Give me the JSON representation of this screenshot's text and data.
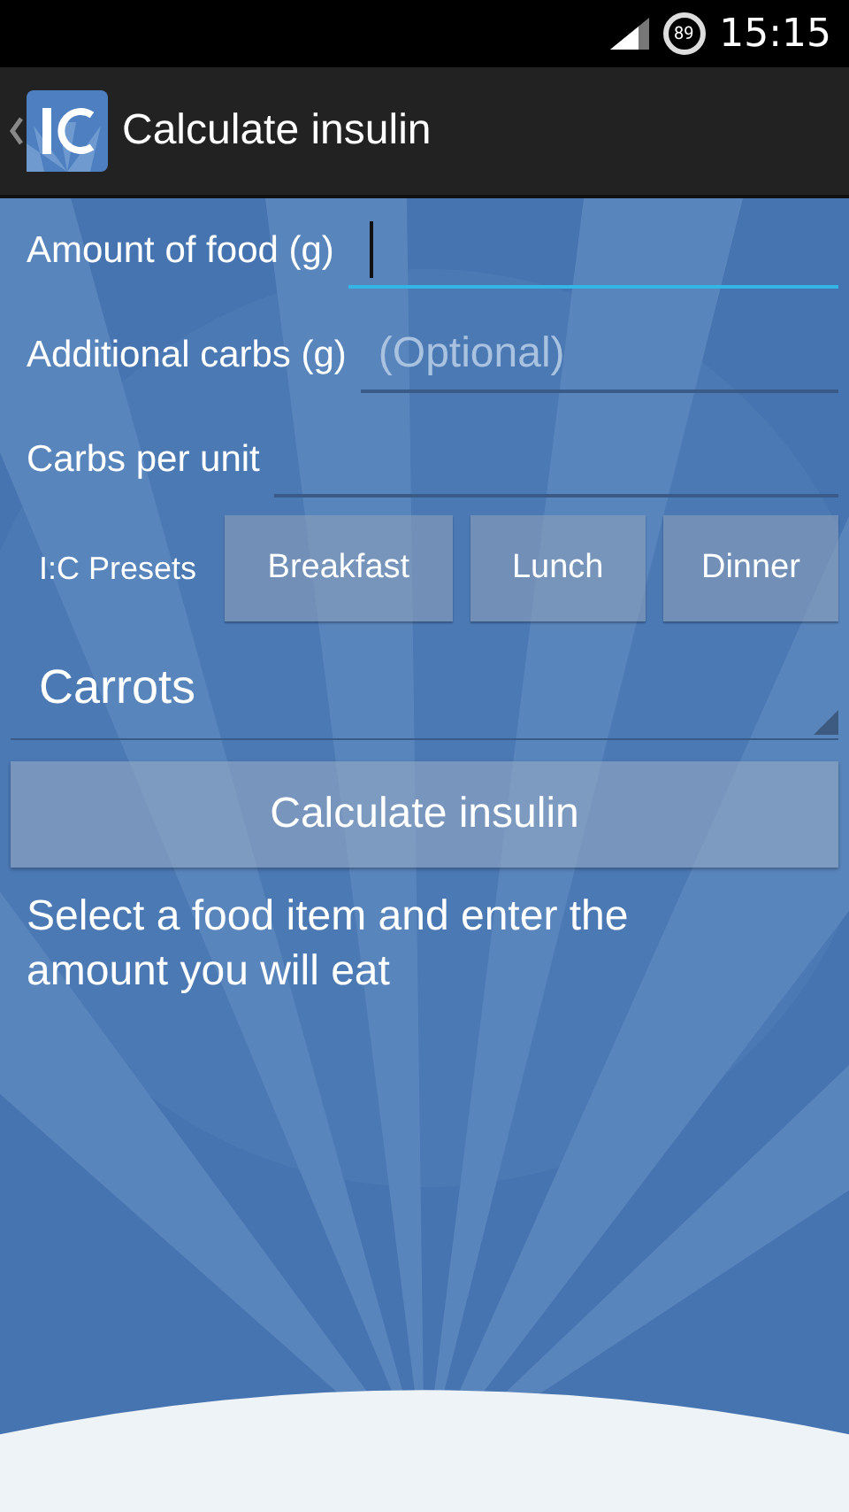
{
  "status_bar": {
    "battery": "89",
    "time": "15:15"
  },
  "action_bar": {
    "title": "Calculate insulin"
  },
  "fields": [
    {
      "label": "Amount of food (g)",
      "focused": true
    },
    {
      "label": "Additional carbs (g)",
      "placeholder": "(Optional)",
      "focused": false
    },
    {
      "label": "Carbs per unit",
      "focused": false
    }
  ],
  "presets": {
    "label": "I:C Presets",
    "buttons": [
      "Breakfast",
      "Lunch",
      "Dinner"
    ]
  },
  "food_spinner": {
    "value": "Carrots"
  },
  "calculate_button": "Calculate insulin",
  "message": "Select a food item and enter the amount you will eat"
}
